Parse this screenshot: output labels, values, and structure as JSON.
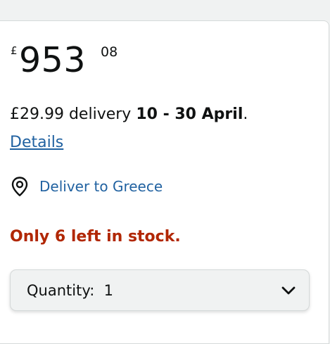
{
  "price": {
    "currency_symbol": "£",
    "whole": "953",
    "fraction": "08"
  },
  "delivery": {
    "prefix": "£29.99 delivery ",
    "dates": "10 - 30 April",
    "suffix": ".",
    "details_link": "Details"
  },
  "location": {
    "label": "Deliver to Greece",
    "icon": "location-pin-icon"
  },
  "stock": {
    "message": "Only 6 left in stock."
  },
  "quantity": {
    "label": "Quantity:",
    "value": "1",
    "icon": "chevron-down-icon"
  },
  "colors": {
    "link": "#2162a1",
    "stock_warning": "#b12704",
    "text": "#0f1111"
  }
}
